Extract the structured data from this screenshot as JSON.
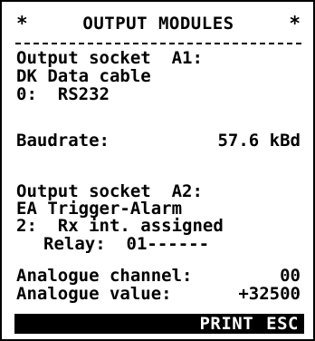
{
  "header": {
    "title": "OUTPUT MODULES",
    "left_star": "*",
    "right_star": "*"
  },
  "socket_a1": {
    "heading": "Output socket  A1:",
    "module": "DK Data cable",
    "mode": "0:  RS232"
  },
  "baudrate": {
    "label": "Baudrate:",
    "value": "57.6 kBd"
  },
  "socket_a2": {
    "heading": "Output socket  A2:",
    "module": "EA Trigger-Alarm",
    "mode": "2:  Rx int. assigned",
    "relay": "Relay:  01------"
  },
  "analogue": {
    "channel_label": "Analogue channel:",
    "channel_value": "00",
    "value_label": "Analogue value:",
    "value": "+32500"
  },
  "softkeys": {
    "print": "PRINT",
    "esc": "ESC"
  }
}
